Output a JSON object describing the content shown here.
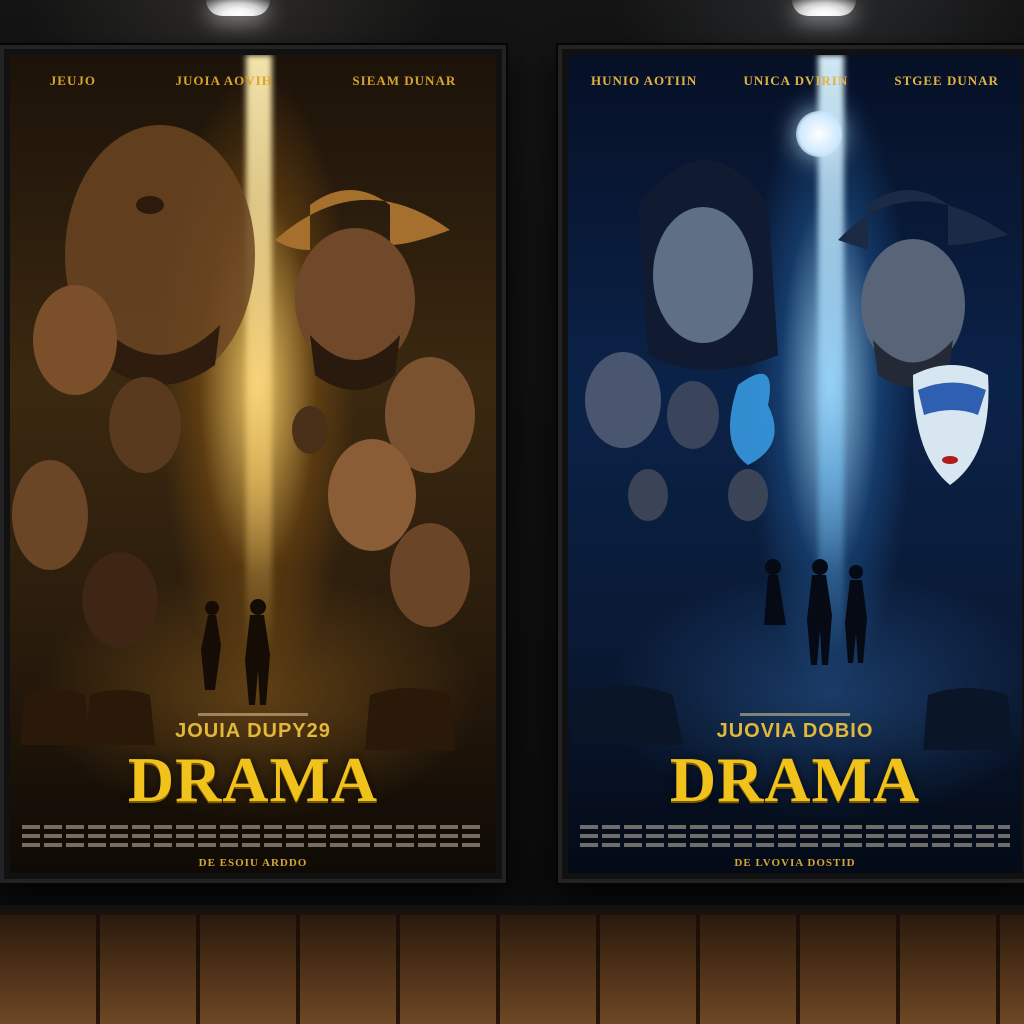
{
  "posters": {
    "left": {
      "top_credits": [
        "JEUJO",
        "JUOIA AOVIH",
        "SIEAM DUNAR"
      ],
      "subtitle": "JOUIA DUPY29",
      "title": "DRAMA",
      "bottom_credit": "DE ESOIU ARDDO"
    },
    "right": {
      "top_credits": [
        "HUNIO AOTIIN",
        "UNICA DVIRIN",
        "STGEE DUNAR"
      ],
      "subtitle": "JUOVIA DOBIO",
      "title": "DRAMA",
      "bottom_credit": "DE LVOVIA DOSTID"
    }
  },
  "colors": {
    "title_yellow": "#f2c21c",
    "left_tone": "#d9a42b",
    "right_tone": "#0b2248"
  }
}
